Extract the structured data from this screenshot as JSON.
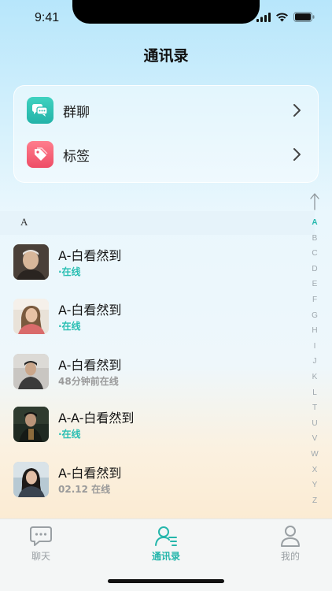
{
  "status_bar": {
    "time": "9:41",
    "icons": [
      "signal-icon",
      "wifi-icon",
      "battery-icon"
    ]
  },
  "header": {
    "title": "通讯录"
  },
  "quick_links": [
    {
      "label": "群聊",
      "icon": "group-chat-icon",
      "color": "#2ec4b6"
    },
    {
      "label": "标签",
      "icon": "tag-icon",
      "color": "#f0566e"
    }
  ],
  "section": {
    "letter": "A"
  },
  "contacts": [
    {
      "name": "A-白看然到",
      "status": "·在线",
      "online": true
    },
    {
      "name": "A-白看然到",
      "status": "·在线",
      "online": true
    },
    {
      "name": "A-白看然到",
      "status": "48分钟前在线",
      "online": false
    },
    {
      "name": "A-A-白看然到",
      "status": "·在线",
      "online": true
    },
    {
      "name": "A-白看然到",
      "status": "02.12 在线",
      "online": false
    }
  ],
  "index_bar": {
    "letters": [
      "A",
      "B",
      "C",
      "D",
      "E",
      "F",
      "G",
      "H",
      "I",
      "J",
      "K",
      "L",
      "T",
      "U",
      "V",
      "W",
      "X",
      "Y",
      "Z"
    ],
    "active": "A"
  },
  "tab_bar": {
    "tabs": [
      {
        "label": "聊天",
        "icon": "chat-bubble-icon",
        "active": false
      },
      {
        "label": "通讯录",
        "icon": "contacts-icon",
        "active": true
      },
      {
        "label": "我的",
        "icon": "profile-icon",
        "active": false
      }
    ]
  },
  "colors": {
    "accent": "#24b6ab",
    "offline": "#9a9a9a"
  }
}
